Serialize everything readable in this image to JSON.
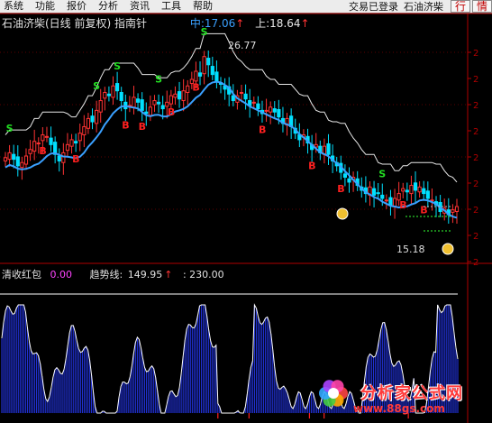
{
  "menu": {
    "items": [
      "系统",
      "功能",
      "报价",
      "分析",
      "资讯",
      "工具",
      "帮助"
    ],
    "status": "交易已登录",
    "stock_name": "石油济柴",
    "buttons": [
      "行",
      "情"
    ]
  },
  "chart_header": {
    "title": "石油济柴(日线 前复权) 指南针",
    "mid_label": "中:",
    "mid_value": "17.06",
    "upper_label": "上:",
    "upper_value": "18.64"
  },
  "price_labels": {
    "high": "26.77",
    "low": "15.18"
  },
  "indicator_header": {
    "name": "清收红包",
    "name_value": "0.00",
    "trend_label": "趋势线:",
    "trend_value": "149.95",
    "extra_value": ": 230.00"
  },
  "watermark": {
    "brand": "分析家公式网",
    "url": "www.88gs.com"
  },
  "colors": {
    "up": "#ff3333",
    "down": "#00e0ff",
    "ma": "#3aa0ff",
    "upper_band": "#e8e8e8",
    "signal_b": "#ff2020",
    "signal_s": "#22dd22",
    "indicator_fill": "#2030d0",
    "indicator_line": "#ffffff"
  },
  "chart_data": [
    {
      "type": "candlestick",
      "title": "石油济柴(日线 前复权) 指南针",
      "y_axis": "price",
      "high_marker": 26.77,
      "low_marker": 15.18,
      "series": [
        {
          "name": "中",
          "last": 17.06
        },
        {
          "name": "上",
          "last": 18.64
        }
      ],
      "close": [
        20.1,
        20.4,
        20.0,
        19.6,
        19.8,
        20.2,
        20.6,
        21.1,
        21.0,
        21.5,
        21.4,
        20.9,
        20.3,
        19.9,
        20.4,
        20.9,
        21.2,
        21.0,
        21.6,
        22.0,
        22.5,
        22.3,
        23.0,
        23.6,
        24.1,
        23.9,
        24.5,
        24.2,
        23.6,
        23.1,
        23.3,
        23.8,
        23.5,
        23.0,
        22.8,
        23.2,
        23.6,
        23.4,
        23.1,
        23.5,
        23.9,
        24.0,
        23.7,
        24.2,
        24.5,
        24.9,
        25.4,
        25.1,
        26.3,
        25.8,
        25.2,
        24.8,
        24.6,
        24.3,
        24.0,
        23.6,
        23.9,
        24.1,
        23.7,
        23.3,
        23.5,
        23.1,
        22.8,
        23.0,
        23.2,
        22.9,
        22.6,
        22.2,
        22.5,
        22.0,
        21.6,
        21.2,
        21.5,
        21.0,
        20.6,
        20.9,
        20.4,
        20.8,
        20.3,
        19.9,
        19.6,
        19.2,
        18.9,
        18.6,
        18.9,
        18.4,
        18.1,
        17.9,
        18.3,
        17.8,
        17.9,
        17.6,
        17.5,
        17.2,
        17.6,
        17.9,
        18.2,
        18.0,
        18.4,
        18.1,
        18.3,
        17.9,
        17.6,
        17.5,
        17.2,
        16.8,
        17.0,
        16.6,
        16.9,
        17.1
      ]
    },
    {
      "type": "bar",
      "title": "清收红包",
      "series": [
        {
          "name": "趋势线",
          "last": 149.95
        }
      ],
      "reference_level": 230.0
    }
  ]
}
